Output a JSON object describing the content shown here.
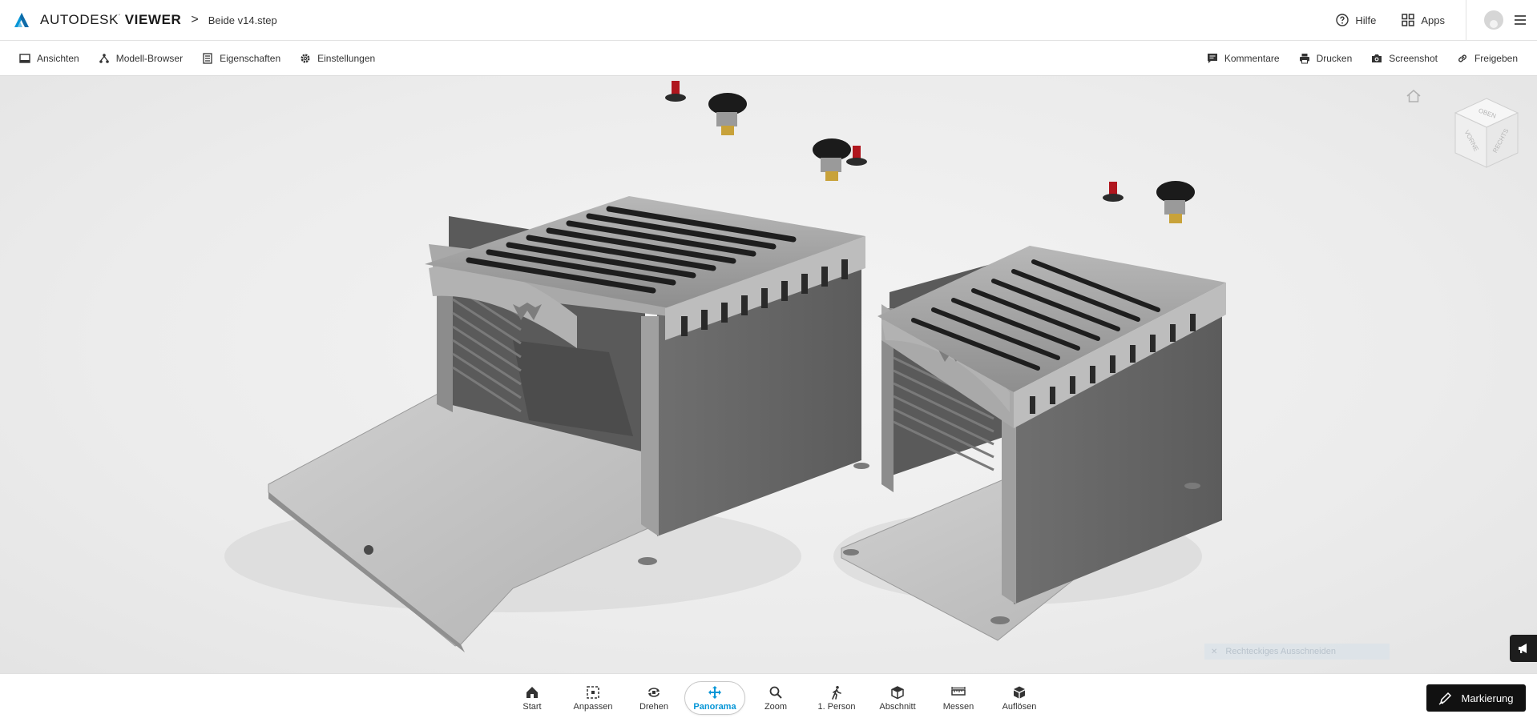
{
  "header": {
    "brand_main": "AUTODESK",
    "brand_bold": "VIEWER",
    "breadcrumb_sep": ">",
    "filename": "Beide v14.step",
    "help_label": "Hilfe",
    "apps_label": "Apps"
  },
  "toolbar": {
    "left": [
      {
        "label": "Ansichten",
        "icon": "views-icon"
      },
      {
        "label": "Modell-Browser",
        "icon": "model-tree-icon"
      },
      {
        "label": "Eigenschaften",
        "icon": "properties-icon"
      },
      {
        "label": "Einstellungen",
        "icon": "gear-icon"
      }
    ],
    "right": [
      {
        "label": "Kommentare",
        "icon": "comment-icon"
      },
      {
        "label": "Drucken",
        "icon": "print-icon"
      },
      {
        "label": "Screenshot",
        "icon": "camera-icon"
      },
      {
        "label": "Freigeben",
        "icon": "link-icon"
      }
    ]
  },
  "viewport": {
    "viewcube_faces": [
      "OBEN",
      "VORNE",
      "RECHTS"
    ],
    "crop_hint": "Rechteckiges Ausschneiden",
    "model_color": "#9a9a9a"
  },
  "bottom_tools": [
    {
      "label": "Start",
      "icon": "home-icon"
    },
    {
      "label": "Anpassen",
      "icon": "fit-icon"
    },
    {
      "label": "Drehen",
      "icon": "orbit-icon"
    },
    {
      "label": "Panorama",
      "icon": "pan-icon",
      "active": true
    },
    {
      "label": "Zoom",
      "icon": "zoom-icon"
    },
    {
      "label": "1. Person",
      "icon": "walk-icon"
    },
    {
      "label": "Abschnitt",
      "icon": "section-icon"
    },
    {
      "label": "Messen",
      "icon": "measure-icon"
    },
    {
      "label": "Auflösen",
      "icon": "explode-icon"
    }
  ],
  "markup_label": "Markierung",
  "colors": {
    "accent": "#0696d7",
    "brand_logo": "#0696d7",
    "markup_bg": "#111111"
  }
}
